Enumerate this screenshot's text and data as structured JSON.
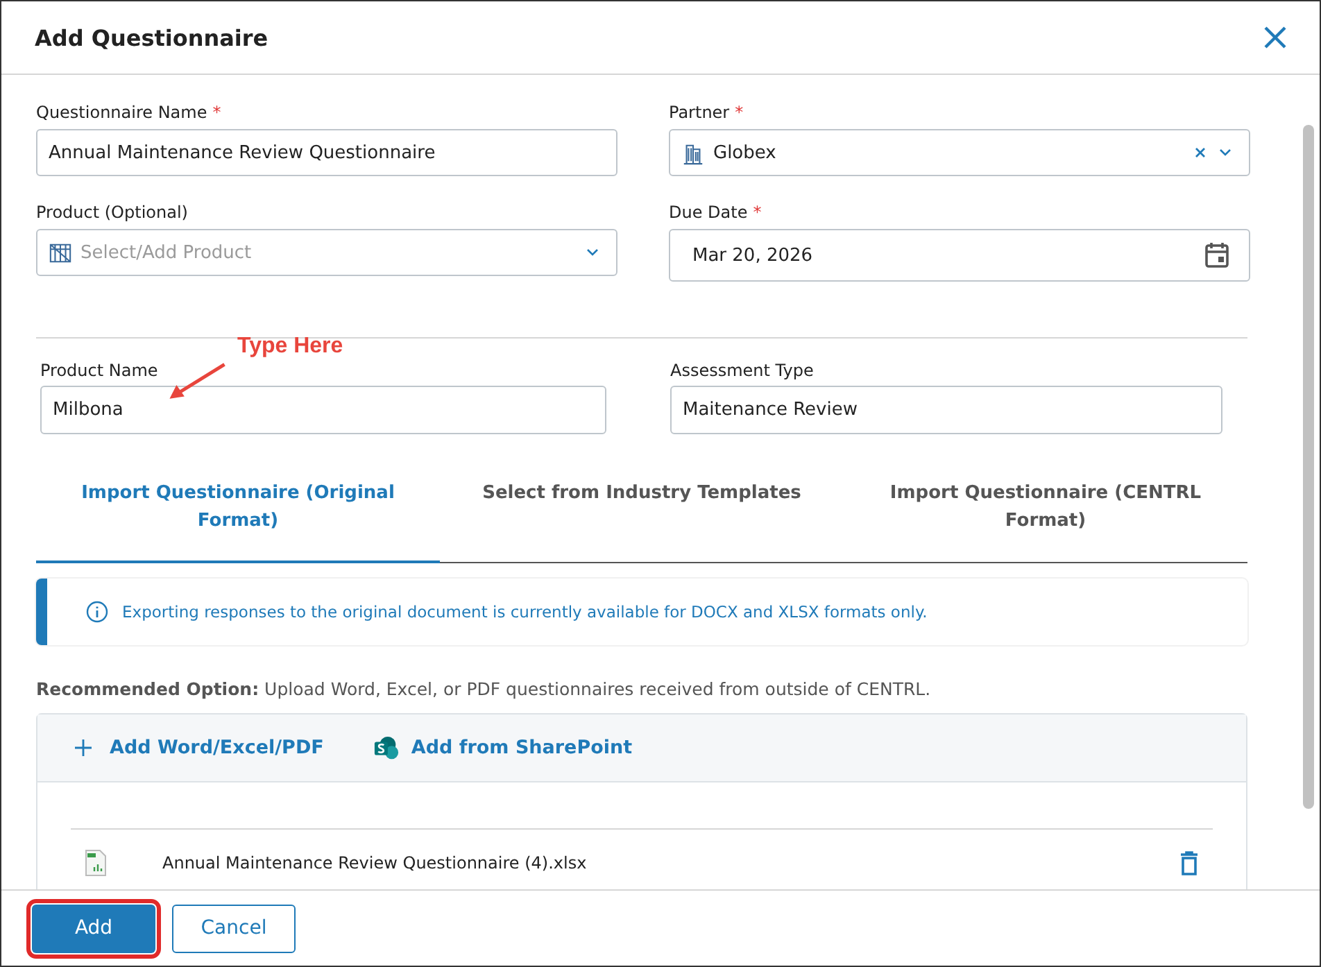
{
  "dialog": {
    "title": "Add Questionnaire"
  },
  "fields": [
    {
      "kind": "text",
      "label": "Questionnaire Name",
      "required_mark": "*",
      "value": "Annual Maintenance Review Questionnaire"
    },
    {
      "kind": "select",
      "label": "Partner",
      "required_mark": "*",
      "value": "Globex",
      "clearable": true
    },
    {
      "kind": "select",
      "label": "Product (Optional)",
      "placeholder": "Select/Add Product",
      "clearable": false
    },
    {
      "kind": "date",
      "label": "Due Date",
      "required_mark": "*",
      "value": "Mar 20, 2026"
    }
  ],
  "product_fields": [
    {
      "label": "Product Name",
      "value": "Milbona"
    },
    {
      "label": "Assessment Type",
      "value": "Maitenance Review"
    }
  ],
  "annotation": {
    "text": "Type Here"
  },
  "tabs": [
    {
      "label": "Import Questionnaire (Original Format)",
      "selected": true
    },
    {
      "label": "Select from Industry Templates",
      "selected": false
    },
    {
      "label": "Import Questionnaire (CENTRL Format)",
      "selected": false
    }
  ],
  "info_banner": "Exporting responses to the original document is currently available for DOCX and XLSX formats only.",
  "recommendation": "**Recommended Option:** Upload Word, Excel, or PDF questionnaires received from outside of CENTRL.",
  "upload_actions": [
    {
      "kind": "add",
      "label": "Add Word/Excel/PDF"
    },
    {
      "kind": "sharepoint",
      "label": "Add from SharePoint"
    }
  ],
  "files": [
    {
      "name": "Annual Maintenance Review Questionnaire (4).xlsx"
    }
  ],
  "buttons": [
    {
      "label": "Add",
      "kind": "primary",
      "highlighted": true
    },
    {
      "label": "Cancel",
      "kind": "secondary",
      "highlighted": false
    }
  ]
}
